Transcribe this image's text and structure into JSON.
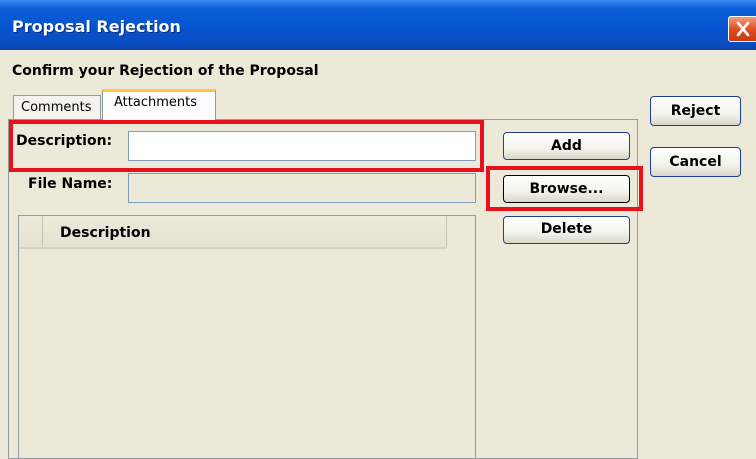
{
  "window": {
    "title": "Proposal Rejection",
    "close_icon": "close-icon"
  },
  "dialog": {
    "subtitle": "Confirm your Rejection of the Proposal"
  },
  "tabs": [
    {
      "label": "Comments",
      "active": false
    },
    {
      "label": "Attachments",
      "active": true
    }
  ],
  "attachments": {
    "description_label": "Description:",
    "description_value": "",
    "file_name_label": "File Name:",
    "file_name_value": "",
    "add_label": "Add",
    "browse_label": "Browse...",
    "delete_label": "Delete",
    "table": {
      "columns": [
        "",
        "Description"
      ],
      "rows": []
    }
  },
  "actions": {
    "reject_label": "Reject",
    "cancel_label": "Cancel"
  },
  "colors": {
    "titlebar": "#0553d0",
    "highlight": "#e8101a",
    "active_tab_accent": "#ffc83c",
    "close_button": "#de4a1c",
    "dialog_background": "#ece9d8"
  }
}
